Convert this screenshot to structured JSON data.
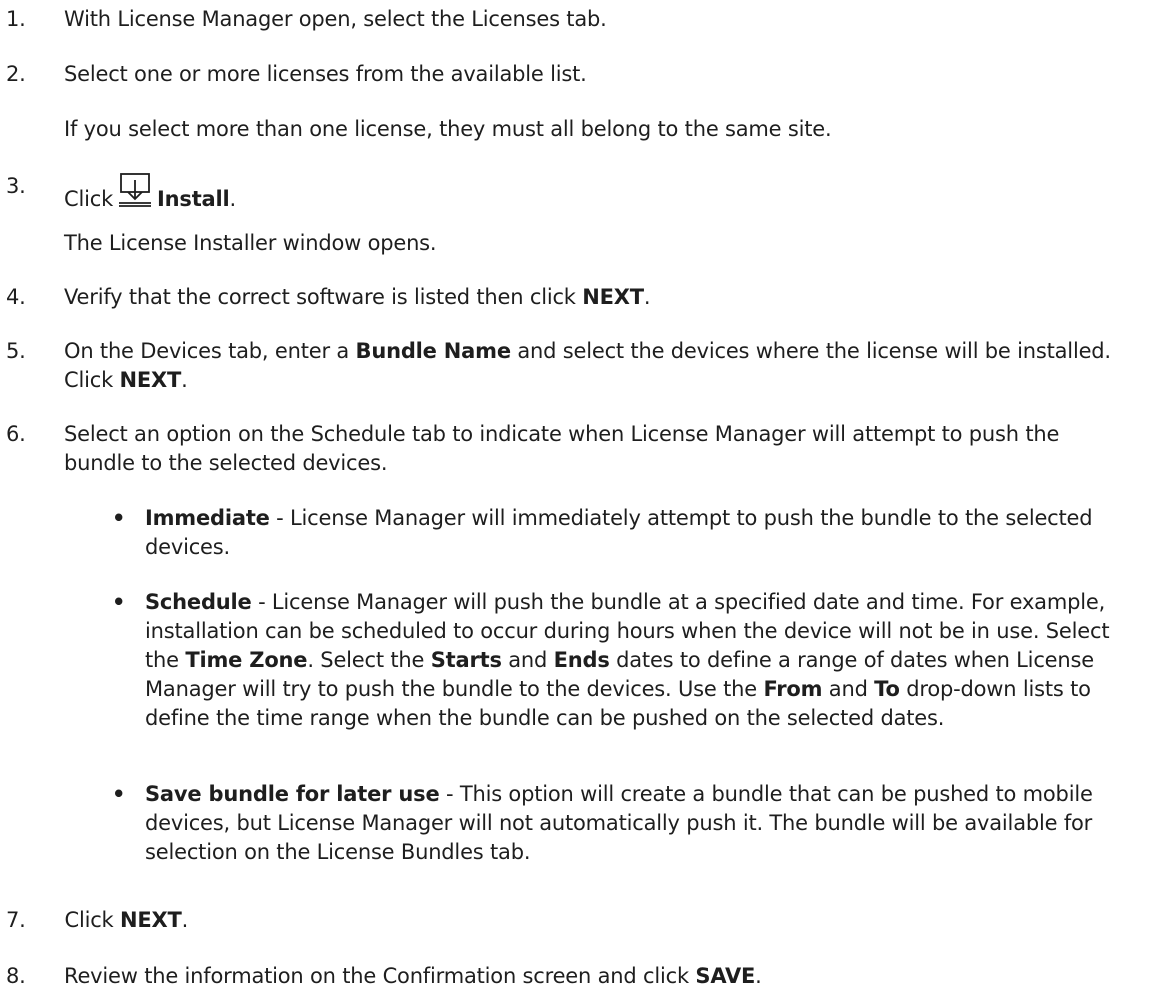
{
  "steps": {
    "s1": {
      "num": "1.",
      "text": "With License Manager open, select the Licenses tab."
    },
    "s2": {
      "num": "2.",
      "text": "Select one or more licenses from the available list."
    },
    "s2_note": "If you select more than one license, they must all belong to the same site.",
    "s3": {
      "num": "3.",
      "pre": "Click",
      "bold": "Install",
      "post": "."
    },
    "s3_note": "The License Installer window opens.",
    "s4": {
      "num": "4.",
      "pre": "Verify that the correct software is listed then click ",
      "bold": "NEXT",
      "post": "."
    },
    "s5": {
      "num": "5.",
      "pre": "On the Devices tab, enter a ",
      "bold1": "Bundle Name",
      "mid": " and select the devices where the license will be installed. Click ",
      "bold2": "NEXT",
      "post": "."
    },
    "s6": {
      "num": "6.",
      "text": "Select an option on the Schedule tab to indicate when License Manager will attempt to push the bundle to the selected devices."
    },
    "b1": {
      "bullet": "•",
      "bold": "Immediate",
      "text": " - License Manager will immediately attempt to push the bundle to the selected devices."
    },
    "b2": {
      "bullet": "•",
      "bold": "Schedule",
      "t1": " - License Manager will push the bundle at a specified date and time. For example, installation can be scheduled to occur during hours when the device will not be in use. Select the ",
      "bold_tz": "Time Zone",
      "t2": ". Select the ",
      "bold_starts": "Starts",
      "t3": " and ",
      "bold_ends": "Ends",
      "t4": " dates to define a range of dates when License Manager will try to push the bundle to the devices. Use the ",
      "bold_from": "From",
      "t5": " and ",
      "bold_to": "To",
      "t6": " drop-down lists to define the time range when the bundle can be pushed on the selected dates."
    },
    "b3": {
      "bullet": "•",
      "bold": "Save bundle for later use",
      "text": " - This option will create a bundle that can be pushed to mobile devices, but License Manager will not automatically push it. The bundle will be available for selection on the License Bundles tab."
    },
    "s7": {
      "num": "7.",
      "pre": " Click ",
      "bold": "NEXT",
      "post": "."
    },
    "s8": {
      "num": "8.",
      "pre": "Review the information on the Confirmation screen and click ",
      "bold": "SAVE",
      "post": "."
    }
  },
  "icons": {
    "install": "install-tray-down-arrow-icon"
  }
}
